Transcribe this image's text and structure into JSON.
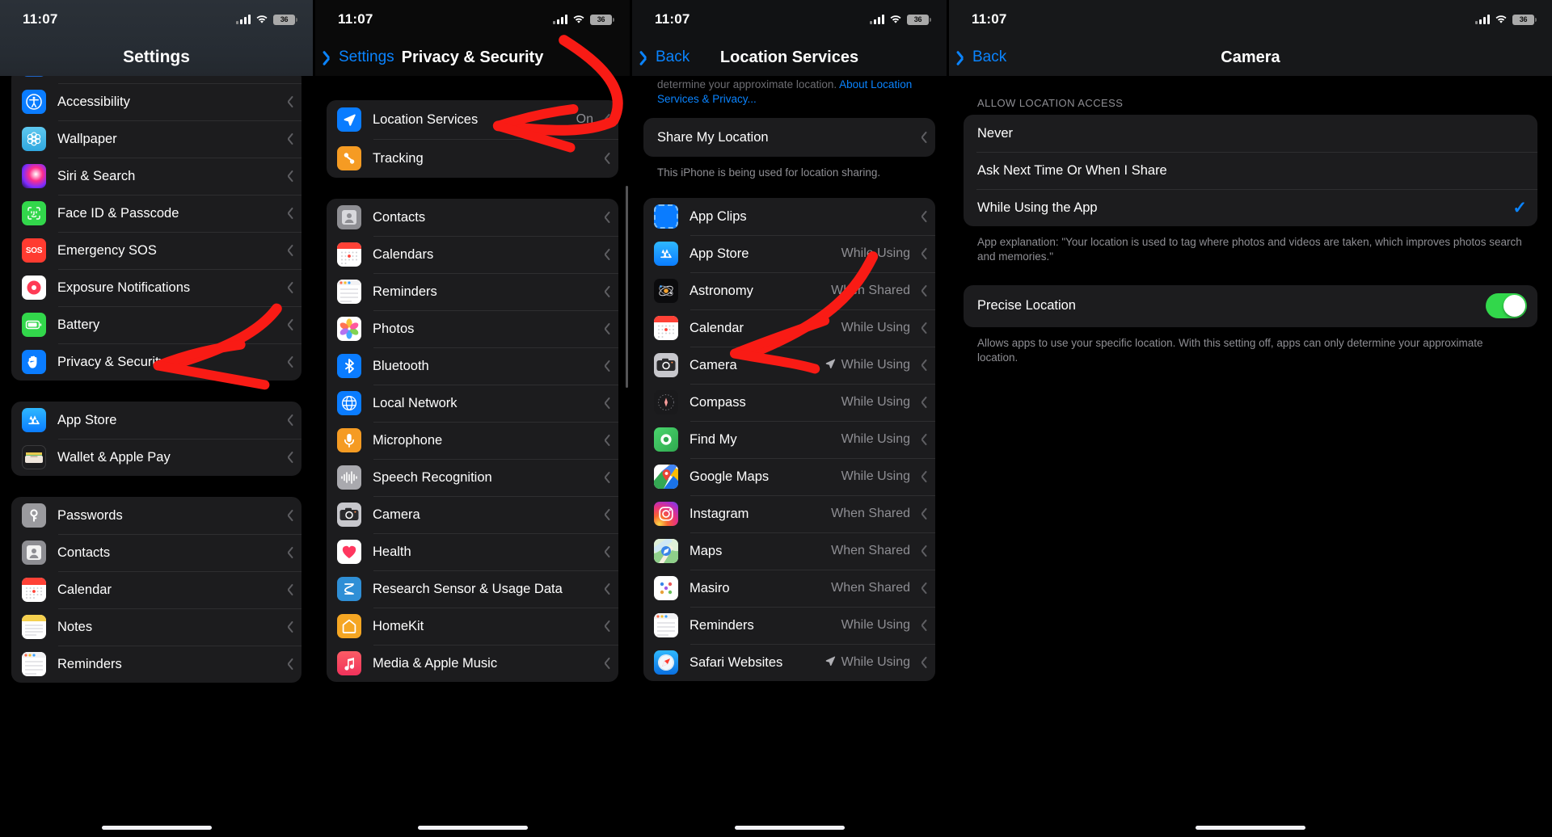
{
  "statusbar": {
    "time": "11:07",
    "battery": "36"
  },
  "panel1": {
    "title": "Settings",
    "groups": [
      {
        "rows": [
          {
            "label": "",
            "icon": "folder-icon",
            "partial": true
          },
          {
            "label": "Accessibility",
            "icon": "accessibility-icon"
          },
          {
            "label": "Wallpaper",
            "icon": "wallpaper-icon"
          },
          {
            "label": "Siri & Search",
            "icon": "siri-icon"
          },
          {
            "label": "Face ID & Passcode",
            "icon": "faceid-icon"
          },
          {
            "label": "Emergency SOS",
            "icon": "sos-icon"
          },
          {
            "label": "Exposure Notifications",
            "icon": "exposure-icon"
          },
          {
            "label": "Battery",
            "icon": "battery-icon"
          },
          {
            "label": "Privacy & Security",
            "icon": "privacy-hand-icon"
          }
        ]
      },
      {
        "rows": [
          {
            "label": "App Store",
            "icon": "appstore-icon"
          },
          {
            "label": "Wallet & Apple Pay",
            "icon": "wallet-icon"
          }
        ]
      },
      {
        "rows": [
          {
            "label": "Passwords",
            "icon": "passwords-key-icon"
          },
          {
            "label": "Contacts",
            "icon": "contacts-icon"
          },
          {
            "label": "Calendar",
            "icon": "calendar-icon"
          },
          {
            "label": "Notes",
            "icon": "notes-icon"
          },
          {
            "label": "Reminders",
            "icon": "reminders-icon"
          }
        ]
      }
    ]
  },
  "panel2": {
    "back_label": "Settings",
    "title": "Privacy & Security",
    "groups": [
      {
        "rows": [
          {
            "label": "Location Services",
            "value": "On",
            "icon": "location-arrow-icon"
          },
          {
            "label": "Tracking",
            "value": "",
            "icon": "tracking-icon"
          }
        ]
      },
      {
        "rows": [
          {
            "label": "Contacts",
            "icon": "contacts-icon"
          },
          {
            "label": "Calendars",
            "icon": "calendar-icon"
          },
          {
            "label": "Reminders",
            "icon": "reminders-icon"
          },
          {
            "label": "Photos",
            "icon": "photos-icon"
          },
          {
            "label": "Bluetooth",
            "icon": "bluetooth-icon"
          },
          {
            "label": "Local Network",
            "icon": "localnetwork-icon"
          },
          {
            "label": "Microphone",
            "icon": "microphone-icon"
          },
          {
            "label": "Speech Recognition",
            "icon": "speech-icon"
          },
          {
            "label": "Camera",
            "icon": "camera-icon"
          },
          {
            "label": "Health",
            "icon": "health-icon"
          },
          {
            "label": "Research Sensor & Usage Data",
            "icon": "research-icon"
          },
          {
            "label": "HomeKit",
            "icon": "homekit-icon"
          },
          {
            "label": "Media & Apple Music",
            "icon": "music-icon"
          }
        ]
      }
    ]
  },
  "panel3": {
    "back_label": "Back",
    "title": "Location Services",
    "top_note_line1": "determine your approximate location.",
    "top_note_link": "About Location Services & Privacy...",
    "share_row": "Share My Location",
    "share_footer": "This iPhone is being used for location sharing.",
    "apps": [
      {
        "label": "App Clips",
        "value": "",
        "icon": "appclips-icon",
        "arrow": false
      },
      {
        "label": "App Store",
        "value": "While Using",
        "icon": "appstore-icon",
        "arrow": false
      },
      {
        "label": "Astronomy",
        "value": "When Shared",
        "icon": "astronomy-icon",
        "arrow": false
      },
      {
        "label": "Calendar",
        "value": "While Using",
        "icon": "calendar-icon",
        "arrow": false
      },
      {
        "label": "Camera",
        "value": "While Using",
        "icon": "camera-icon",
        "arrow": true
      },
      {
        "label": "Compass",
        "value": "While Using",
        "icon": "compass-icon",
        "arrow": false
      },
      {
        "label": "Find My",
        "value": "While Using",
        "icon": "findmy-icon",
        "arrow": false
      },
      {
        "label": "Google Maps",
        "value": "While Using",
        "icon": "googlemaps-icon",
        "arrow": false
      },
      {
        "label": "Instagram",
        "value": "When Shared",
        "icon": "instagram-icon",
        "arrow": false
      },
      {
        "label": "Maps",
        "value": "When Shared",
        "icon": "maps-icon",
        "arrow": false
      },
      {
        "label": "Masiro",
        "value": "When Shared",
        "icon": "masiro-icon",
        "arrow": false
      },
      {
        "label": "Reminders",
        "value": "While Using",
        "icon": "reminders-icon",
        "arrow": false
      },
      {
        "label": "Safari Websites",
        "value": "While Using",
        "icon": "safari-icon",
        "arrow": true
      }
    ]
  },
  "panel4": {
    "back_label": "Back",
    "title": "Camera",
    "section_header": "ALLOW LOCATION ACCESS",
    "options": [
      {
        "label": "Never",
        "selected": false
      },
      {
        "label": "Ask Next Time Or When I Share",
        "selected": false
      },
      {
        "label": "While Using the App",
        "selected": true
      }
    ],
    "explanation": "App explanation: \"Your location is used to tag where photos and videos are taken, which improves photos search and memories.\"",
    "precise_label": "Precise Location",
    "precise_on": true,
    "precise_footer": "Allows apps to use your specific location. With this setting off, apps can only determine your approximate location."
  },
  "colors": {
    "accent_blue": "#0a84ff",
    "annotation_red": "#f91b15",
    "toggle_green": "#32d74b",
    "group_bg": "#1c1c1e",
    "secondary_text": "#8e8e93"
  }
}
